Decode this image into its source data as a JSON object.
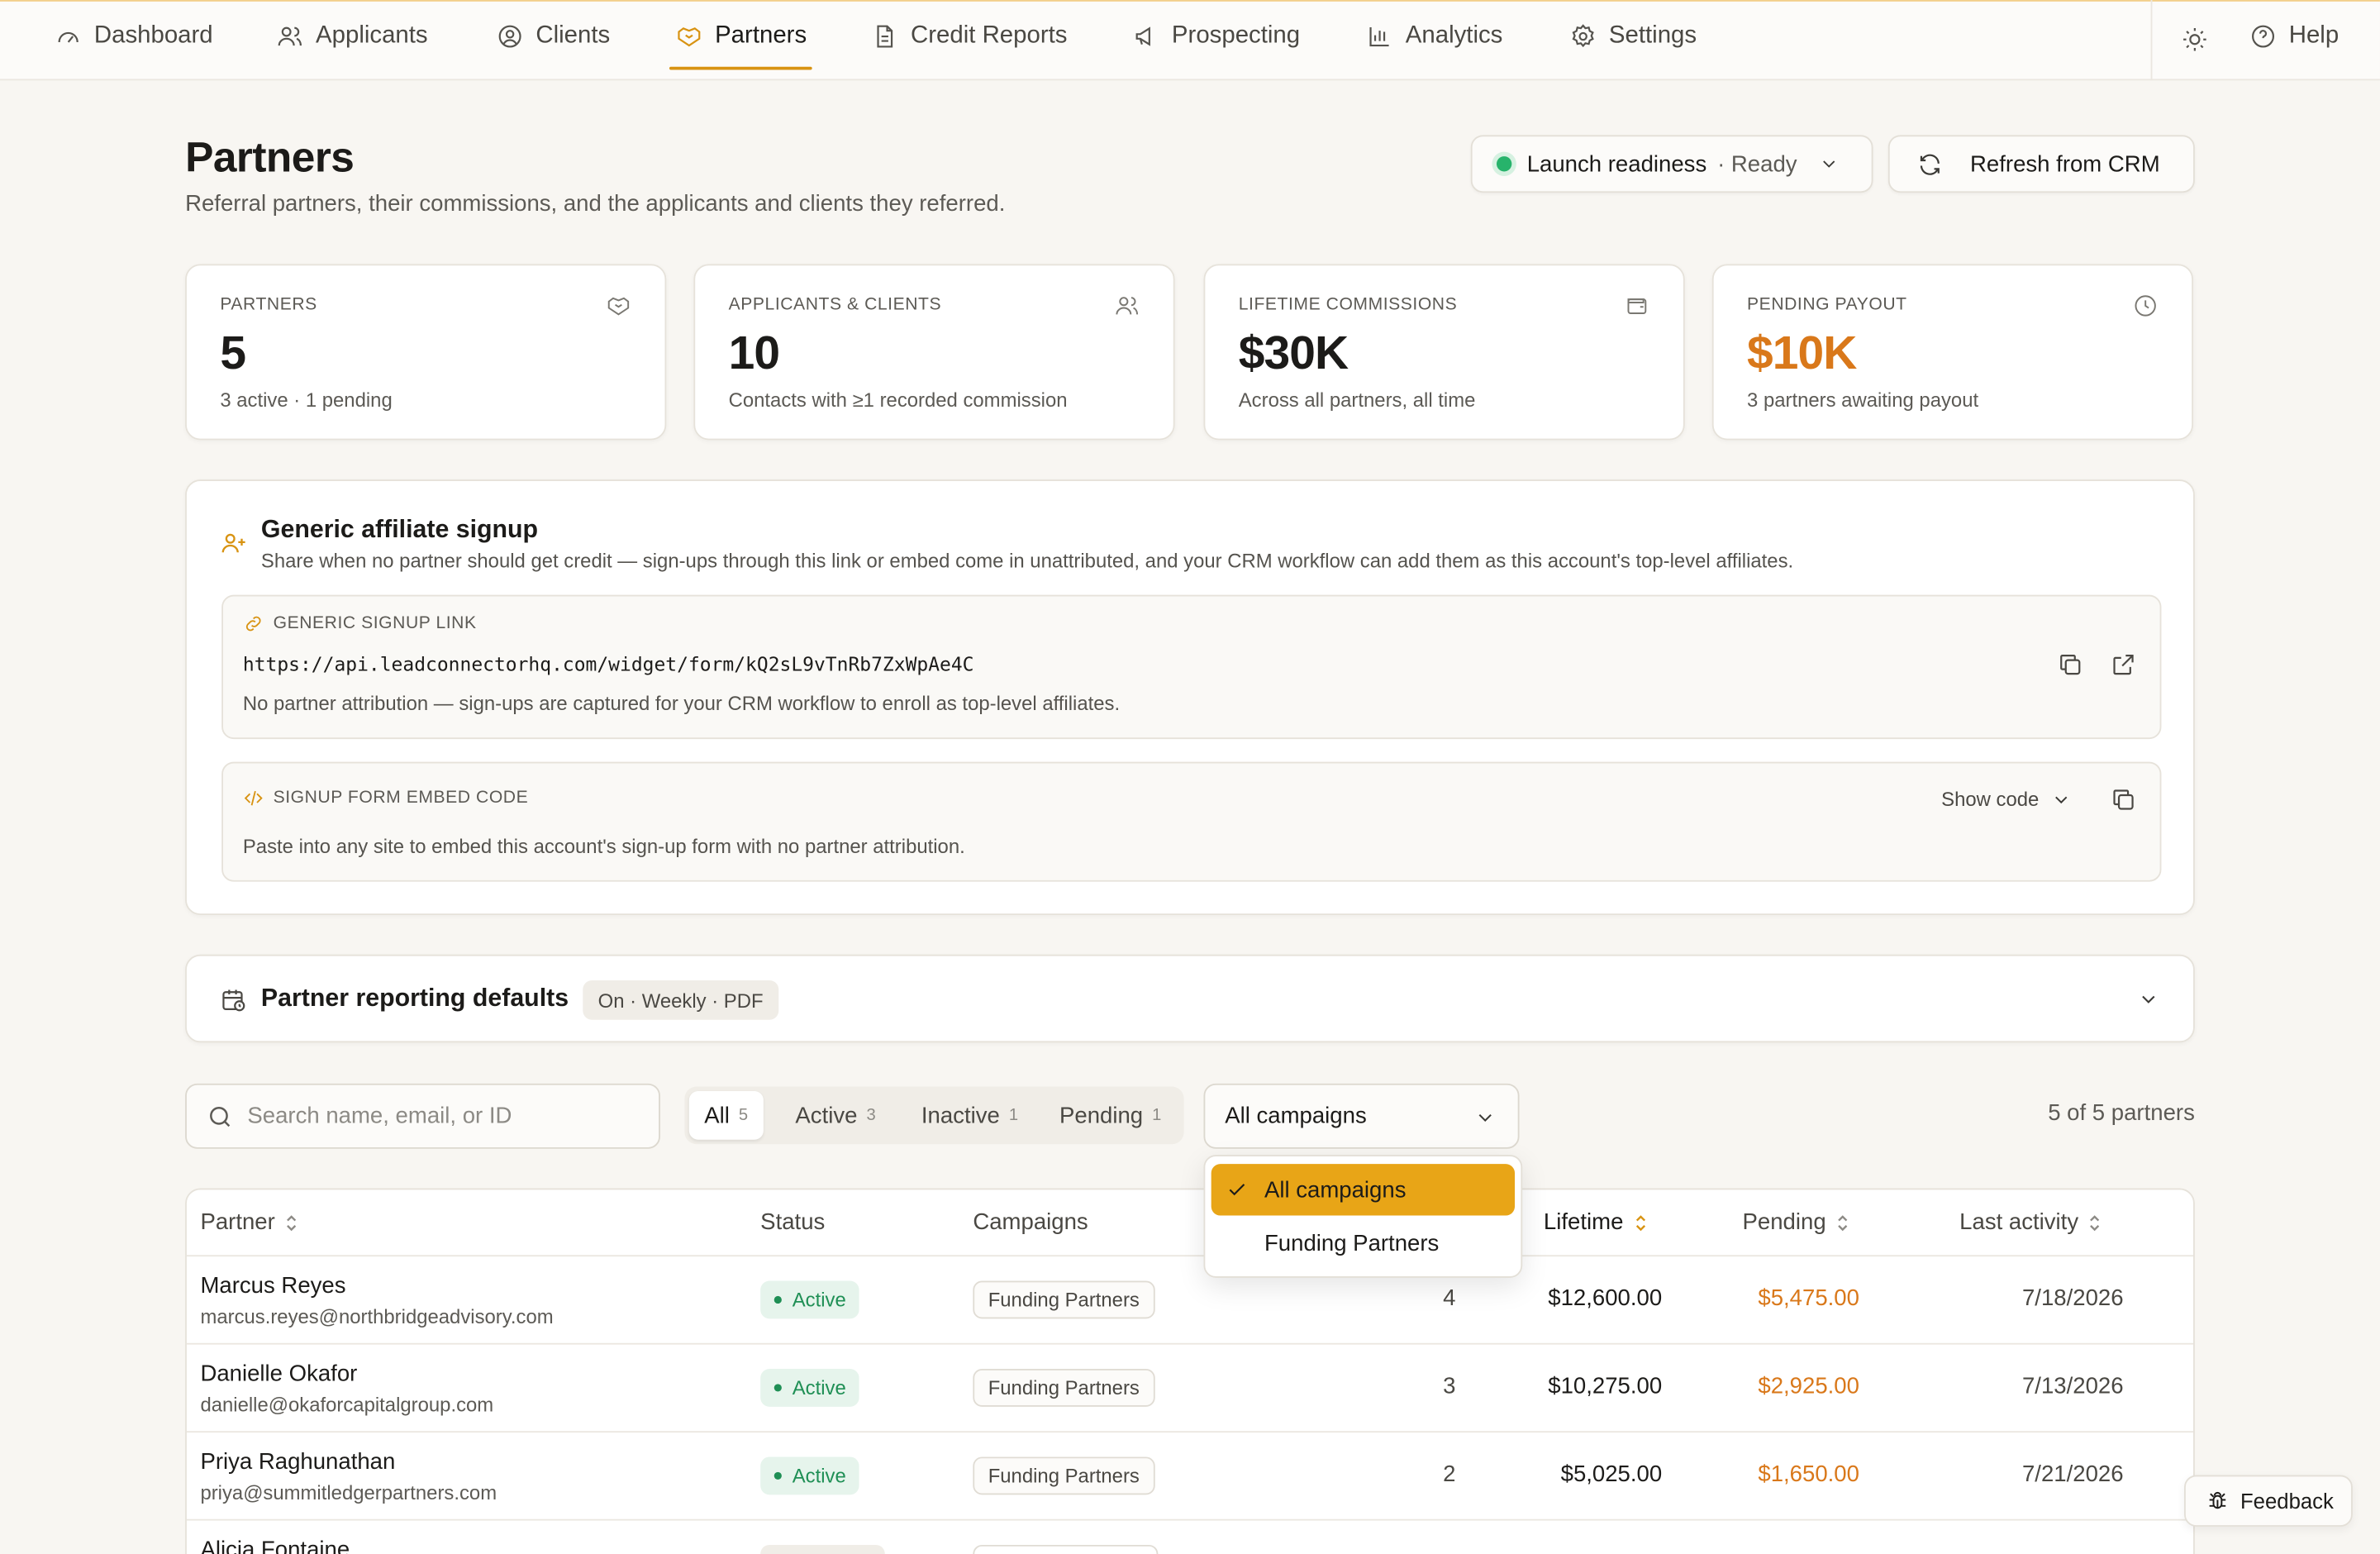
{
  "nav": {
    "items": [
      {
        "label": "Dashboard",
        "icon": "gauge-icon"
      },
      {
        "label": "Applicants",
        "icon": "users-icon"
      },
      {
        "label": "Clients",
        "icon": "user-circle-icon"
      },
      {
        "label": "Partners",
        "icon": "handshake-icon",
        "active": true
      },
      {
        "label": "Credit Reports",
        "icon": "file-text-icon"
      },
      {
        "label": "Prospecting",
        "icon": "megaphone-icon"
      },
      {
        "label": "Analytics",
        "icon": "bar-chart-icon"
      },
      {
        "label": "Settings",
        "icon": "gear-icon"
      }
    ],
    "help_label": "Help"
  },
  "header": {
    "title": "Partners",
    "subtitle": "Referral partners, their commissions, and the applicants and clients they referred.",
    "readiness_label": "Launch readiness",
    "readiness_status": "· Ready",
    "refresh_label": "Refresh from CRM"
  },
  "stats": [
    {
      "label": "PARTNERS",
      "value": "5",
      "note": "3 active · 1 pending",
      "icon": "handshake-icon"
    },
    {
      "label": "APPLICANTS & CLIENTS",
      "value": "10",
      "note": "Contacts with ≥1 recorded commission",
      "icon": "users-icon"
    },
    {
      "label": "LIFETIME COMMISSIONS",
      "value": "$30K",
      "note": "Across all partners, all time",
      "icon": "wallet-icon"
    },
    {
      "label": "PENDING PAYOUT",
      "value": "$10K",
      "note": "3 partners awaiting payout",
      "icon": "clock-icon"
    }
  ],
  "affiliate": {
    "title": "Generic affiliate signup",
    "description": "Share when no partner should get credit — sign-ups through this link or embed come in unattributed, and your CRM workflow can add them as this account's top-level affiliates.",
    "link_label": "GENERIC SIGNUP LINK",
    "link_url": "https://api.leadconnectorhq.com/widget/form/kQ2sL9vTnRb7ZxWpAe4C",
    "link_note": "No partner attribution — sign-ups are captured for your CRM workflow to enroll as top-level affiliates.",
    "embed_label": "SIGNUP FORM EMBED CODE",
    "embed_note": "Paste into any site to embed this account's sign-up form with no partner attribution.",
    "show_code_label": "Show code"
  },
  "reporting": {
    "title": "Partner reporting defaults",
    "badge": "On · Weekly · PDF"
  },
  "filters": {
    "search_placeholder": "Search name, email, or ID",
    "segments": [
      {
        "label": "All",
        "count": "5",
        "active": true
      },
      {
        "label": "Active",
        "count": "3"
      },
      {
        "label": "Inactive",
        "count": "1"
      },
      {
        "label": "Pending",
        "count": "1"
      }
    ],
    "campaign_selected": "All campaigns",
    "campaign_options": [
      "All campaigns",
      "Funding Partners"
    ],
    "result_count": "5 of 5 partners"
  },
  "table": {
    "headers": {
      "partner": "Partner",
      "status": "Status",
      "campaigns": "Campaigns",
      "lifetime": "Lifetime",
      "pending": "Pending",
      "last_activity": "Last activity"
    },
    "rows": [
      {
        "name": "Marcus Reyes",
        "email": "marcus.reyes@northbridgeadvisory.com",
        "status": "Active",
        "campaign": "Funding Partners",
        "referrals": "4",
        "lifetime": "$12,600.00",
        "pending": "$5,475.00",
        "last_activity": "7/18/2026"
      },
      {
        "name": "Danielle Okafor",
        "email": "danielle@okaforcapitalgroup.com",
        "status": "Active",
        "campaign": "Funding Partners",
        "referrals": "3",
        "lifetime": "$10,275.00",
        "pending": "$2,925.00",
        "last_activity": "7/13/2026"
      },
      {
        "name": "Priya Raghunathan",
        "email": "priya@summitledgerpartners.com",
        "status": "Active",
        "campaign": "Funding Partners",
        "referrals": "2",
        "lifetime": "$5,025.00",
        "pending": "$1,650.00",
        "last_activity": "7/21/2026"
      },
      {
        "name": "Alicia Fontaine",
        "email": "",
        "status": "",
        "campaign": "",
        "referrals": "",
        "lifetime": "",
        "pending": "",
        "last_activity": ""
      }
    ]
  },
  "feedback_label": "Feedback",
  "colors": {
    "accent": "#d89312",
    "pending": "#d9781a",
    "active_green": "#1f8f55",
    "selected_option": "#e8a517"
  }
}
